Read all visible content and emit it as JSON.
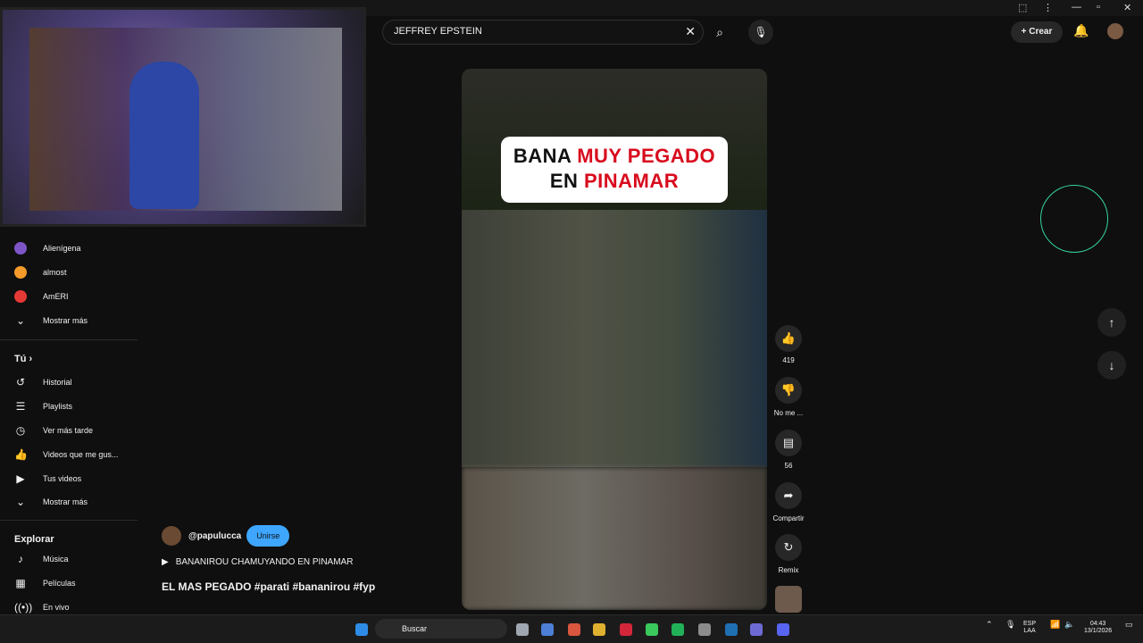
{
  "search": {
    "query": "JEFFREY EPSTEIN"
  },
  "header": {
    "create_label": "Crear"
  },
  "sidebar": {
    "subscriptions": [
      {
        "label": "Alienígena",
        "color": "#7d55c7"
      },
      {
        "label": "almost",
        "color": "#f59b2b"
      },
      {
        "label": "AmERI",
        "color": "#e53935"
      }
    ],
    "show_more_1": "Mostrar más",
    "you_title": "Tú",
    "you_items": [
      "Historial",
      "Playlists",
      "Ver más tarde",
      "Videos que me gus...",
      "Tus videos"
    ],
    "show_more_2": "Mostrar más",
    "explore_title": "Explorar",
    "explore_items": [
      "Música",
      "Películas",
      "En vivo"
    ]
  },
  "video": {
    "caption_line1_white": "BANA ",
    "caption_line1_red": "MUY PEGADO",
    "caption_line2_white": "EN ",
    "caption_line2_red": "PINAMAR"
  },
  "actions": {
    "likes": "419",
    "dislike_label": "No me ...",
    "comments": "56",
    "share_label": "Compartir",
    "remix_label": "Remix"
  },
  "channel": {
    "handle": "@papulucca",
    "join_label": "Unirse"
  },
  "video_info": {
    "playlist_title": "BANANIROU CHAMUYANDO EN PINAMAR",
    "description": "EL MAS PEGADO #parati #bananirou #fyp"
  },
  "taskbar": {
    "search_label": "Buscar",
    "lang1": "ESP",
    "lang2": "LAA",
    "time": "04:43",
    "date": "13/1/2026"
  }
}
